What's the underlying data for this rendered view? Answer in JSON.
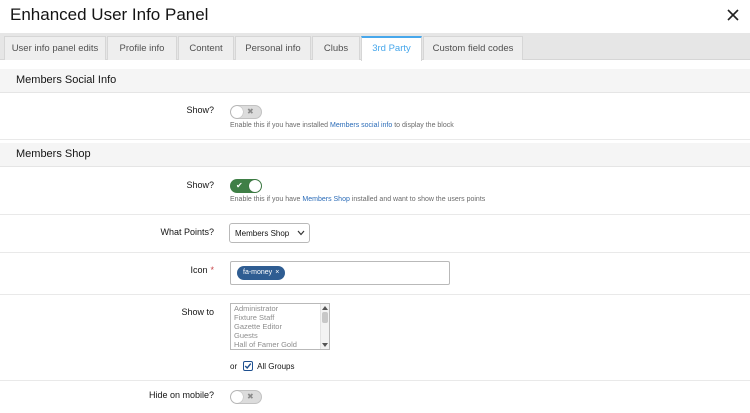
{
  "window": {
    "title": "Enhanced User Info Panel"
  },
  "tabs": [
    {
      "label": "User info panel edits",
      "active": false
    },
    {
      "label": "Profile info",
      "active": false
    },
    {
      "label": "Content",
      "active": false
    },
    {
      "label": "Personal info",
      "active": false
    },
    {
      "label": "Clubs",
      "active": false
    },
    {
      "label": "3rd Party",
      "active": true
    },
    {
      "label": "Custom field codes",
      "active": false
    }
  ],
  "social": {
    "section_title": "Members Social Info",
    "show_label": "Show?",
    "show_enabled": false,
    "hint_before": "Enable this if you have installed ",
    "hint_link": "Members social info",
    "hint_after": " to display the block"
  },
  "shop": {
    "section_title": "Members Shop",
    "show_label": "Show?",
    "show_enabled": true,
    "hint_before": "Enable this if you have ",
    "hint_link": "Members Shop",
    "hint_after": " installed and want to show the users points",
    "points_label": "What Points?",
    "points_value": "Members Shop",
    "icon_label": "Icon",
    "icon_required_mark": "*",
    "icon_tag": "fa-money",
    "icon_tag_remove": "×",
    "show_to_label": "Show to",
    "groups": [
      "Administrator",
      "Fixture Staff",
      "Gazette Editor",
      "Guests",
      "Hall of Famer Gold"
    ],
    "or_text": "or",
    "all_groups_label": "All Groups",
    "all_groups_checked": true,
    "hide_mobile_label": "Hide on mobile?",
    "hide_mobile_enabled": false
  },
  "colors": {
    "accent": "#47a7eb",
    "toggle_on": "#3f7f46",
    "tag_bg": "#2f5d92",
    "link": "#2b6cb8"
  },
  "icons": {
    "close": "close-icon",
    "check": "check-icon",
    "x_mark": "x-mark-icon",
    "caret": "chevron-down-icon"
  }
}
